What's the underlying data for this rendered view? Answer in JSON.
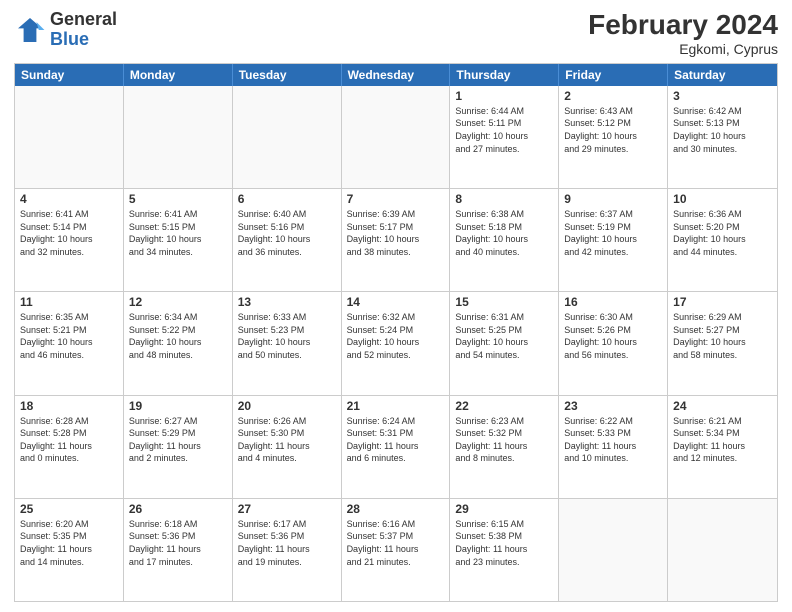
{
  "header": {
    "logo": {
      "general": "General",
      "blue": "Blue"
    },
    "month_year": "February 2024",
    "location": "Egkomi, Cyprus"
  },
  "weekdays": [
    "Sunday",
    "Monday",
    "Tuesday",
    "Wednesday",
    "Thursday",
    "Friday",
    "Saturday"
  ],
  "weeks": [
    [
      {
        "day": "",
        "info": "",
        "empty": true
      },
      {
        "day": "",
        "info": "",
        "empty": true
      },
      {
        "day": "",
        "info": "",
        "empty": true
      },
      {
        "day": "",
        "info": "",
        "empty": true
      },
      {
        "day": "1",
        "info": "Sunrise: 6:44 AM\nSunset: 5:11 PM\nDaylight: 10 hours\nand 27 minutes."
      },
      {
        "day": "2",
        "info": "Sunrise: 6:43 AM\nSunset: 5:12 PM\nDaylight: 10 hours\nand 29 minutes."
      },
      {
        "day": "3",
        "info": "Sunrise: 6:42 AM\nSunset: 5:13 PM\nDaylight: 10 hours\nand 30 minutes."
      }
    ],
    [
      {
        "day": "4",
        "info": "Sunrise: 6:41 AM\nSunset: 5:14 PM\nDaylight: 10 hours\nand 32 minutes."
      },
      {
        "day": "5",
        "info": "Sunrise: 6:41 AM\nSunset: 5:15 PM\nDaylight: 10 hours\nand 34 minutes."
      },
      {
        "day": "6",
        "info": "Sunrise: 6:40 AM\nSunset: 5:16 PM\nDaylight: 10 hours\nand 36 minutes."
      },
      {
        "day": "7",
        "info": "Sunrise: 6:39 AM\nSunset: 5:17 PM\nDaylight: 10 hours\nand 38 minutes."
      },
      {
        "day": "8",
        "info": "Sunrise: 6:38 AM\nSunset: 5:18 PM\nDaylight: 10 hours\nand 40 minutes."
      },
      {
        "day": "9",
        "info": "Sunrise: 6:37 AM\nSunset: 5:19 PM\nDaylight: 10 hours\nand 42 minutes."
      },
      {
        "day": "10",
        "info": "Sunrise: 6:36 AM\nSunset: 5:20 PM\nDaylight: 10 hours\nand 44 minutes."
      }
    ],
    [
      {
        "day": "11",
        "info": "Sunrise: 6:35 AM\nSunset: 5:21 PM\nDaylight: 10 hours\nand 46 minutes."
      },
      {
        "day": "12",
        "info": "Sunrise: 6:34 AM\nSunset: 5:22 PM\nDaylight: 10 hours\nand 48 minutes."
      },
      {
        "day": "13",
        "info": "Sunrise: 6:33 AM\nSunset: 5:23 PM\nDaylight: 10 hours\nand 50 minutes."
      },
      {
        "day": "14",
        "info": "Sunrise: 6:32 AM\nSunset: 5:24 PM\nDaylight: 10 hours\nand 52 minutes."
      },
      {
        "day": "15",
        "info": "Sunrise: 6:31 AM\nSunset: 5:25 PM\nDaylight: 10 hours\nand 54 minutes."
      },
      {
        "day": "16",
        "info": "Sunrise: 6:30 AM\nSunset: 5:26 PM\nDaylight: 10 hours\nand 56 minutes."
      },
      {
        "day": "17",
        "info": "Sunrise: 6:29 AM\nSunset: 5:27 PM\nDaylight: 10 hours\nand 58 minutes."
      }
    ],
    [
      {
        "day": "18",
        "info": "Sunrise: 6:28 AM\nSunset: 5:28 PM\nDaylight: 11 hours\nand 0 minutes."
      },
      {
        "day": "19",
        "info": "Sunrise: 6:27 AM\nSunset: 5:29 PM\nDaylight: 11 hours\nand 2 minutes."
      },
      {
        "day": "20",
        "info": "Sunrise: 6:26 AM\nSunset: 5:30 PM\nDaylight: 11 hours\nand 4 minutes."
      },
      {
        "day": "21",
        "info": "Sunrise: 6:24 AM\nSunset: 5:31 PM\nDaylight: 11 hours\nand 6 minutes."
      },
      {
        "day": "22",
        "info": "Sunrise: 6:23 AM\nSunset: 5:32 PM\nDaylight: 11 hours\nand 8 minutes."
      },
      {
        "day": "23",
        "info": "Sunrise: 6:22 AM\nSunset: 5:33 PM\nDaylight: 11 hours\nand 10 minutes."
      },
      {
        "day": "24",
        "info": "Sunrise: 6:21 AM\nSunset: 5:34 PM\nDaylight: 11 hours\nand 12 minutes."
      }
    ],
    [
      {
        "day": "25",
        "info": "Sunrise: 6:20 AM\nSunset: 5:35 PM\nDaylight: 11 hours\nand 14 minutes."
      },
      {
        "day": "26",
        "info": "Sunrise: 6:18 AM\nSunset: 5:36 PM\nDaylight: 11 hours\nand 17 minutes."
      },
      {
        "day": "27",
        "info": "Sunrise: 6:17 AM\nSunset: 5:36 PM\nDaylight: 11 hours\nand 19 minutes."
      },
      {
        "day": "28",
        "info": "Sunrise: 6:16 AM\nSunset: 5:37 PM\nDaylight: 11 hours\nand 21 minutes."
      },
      {
        "day": "29",
        "info": "Sunrise: 6:15 AM\nSunset: 5:38 PM\nDaylight: 11 hours\nand 23 minutes."
      },
      {
        "day": "",
        "info": "",
        "empty": true
      },
      {
        "day": "",
        "info": "",
        "empty": true
      }
    ]
  ]
}
